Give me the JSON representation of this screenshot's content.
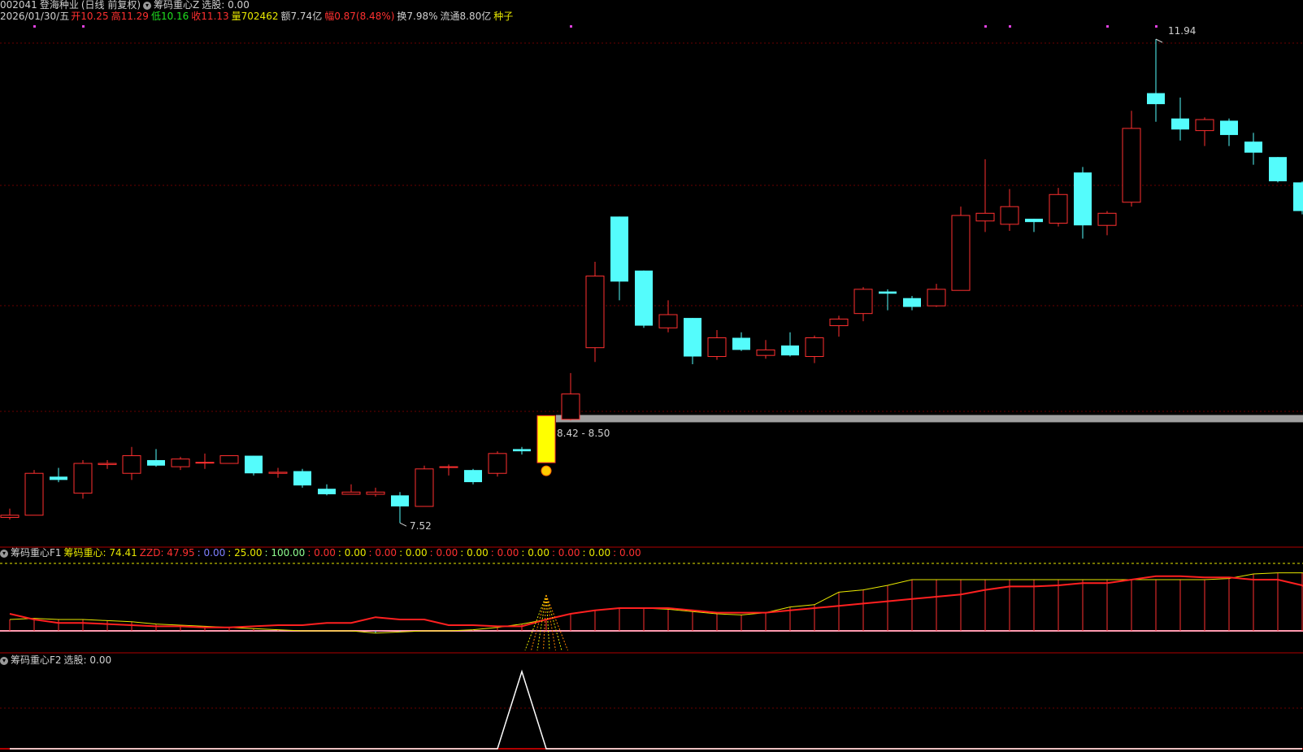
{
  "header": {
    "code": "002041",
    "name": "登海种业",
    "period": "(日线 前复权)",
    "formula": "筹码重心Z",
    "select_label": "选股: 0.00"
  },
  "quote": {
    "date": "2026/01/30/五",
    "open_label": "开10.25",
    "high_label": "高11.29",
    "low_label": "低10.16",
    "close_label": "收11.13",
    "volume_label": "量702462",
    "amount_label": "额7.74亿",
    "change_label": "幅0.87(8.48%)",
    "turnover_label": "换7.98%",
    "float_label": "流通8.80亿",
    "tag": "种子"
  },
  "main_chart": {
    "max_label": "11.94",
    "min_label": "7.52",
    "band_label": "8.42 - 8.50"
  },
  "f1": {
    "title": "筹码重心F1",
    "items": [
      {
        "text": "筹码重心: 74.41",
        "color": "#e8e800"
      },
      {
        "text": "ZZD: 47.95",
        "color": "#ff3030"
      },
      {
        "text": ": 0.00",
        "color": "#8080ff"
      },
      {
        "text": ": 25.00",
        "color": "#e8e800"
      },
      {
        "text": ": 100.00",
        "color": "#90ff90"
      },
      {
        "text": ": 0.00",
        "color": "#ff3030"
      },
      {
        "text": ": 0.00",
        "color": "#e8e800"
      },
      {
        "text": ": 0.00",
        "color": "#ff3030"
      },
      {
        "text": ": 0.00",
        "color": "#e8e800"
      },
      {
        "text": ": 0.00",
        "color": "#ff3030"
      },
      {
        "text": ": 0.00",
        "color": "#e8e800"
      },
      {
        "text": ": 0.00",
        "color": "#ff3030"
      },
      {
        "text": ": 0.00",
        "color": "#e8e800"
      },
      {
        "text": ": 0.00",
        "color": "#ff3030"
      },
      {
        "text": ": 0.00",
        "color": "#e8e800"
      },
      {
        "text": ": 0.00",
        "color": "#ff3030"
      }
    ]
  },
  "f2": {
    "title": "筹码重心F2",
    "select_label": "选股: 0.00"
  },
  "chart_data": {
    "type": "candlestick",
    "up_color": "#ff3030",
    "down_color": "#54fcfc",
    "signal_color": "#ffff00",
    "ylim": [
      7.5,
      12.0
    ],
    "candles": [
      {
        "o": 7.6,
        "h": 7.68,
        "l": 7.58,
        "c": 7.62
      },
      {
        "o": 7.62,
        "h": 8.03,
        "l": 7.62,
        "c": 8.0
      },
      {
        "o": 7.97,
        "h": 8.05,
        "l": 7.92,
        "c": 7.94
      },
      {
        "o": 7.82,
        "h": 8.12,
        "l": 7.77,
        "c": 8.09
      },
      {
        "o": 8.08,
        "h": 8.12,
        "l": 8.04,
        "c": 8.09
      },
      {
        "o": 8.0,
        "h": 8.24,
        "l": 7.94,
        "c": 8.16
      },
      {
        "o": 8.12,
        "h": 8.22,
        "l": 8.06,
        "c": 8.07
      },
      {
        "o": 8.06,
        "h": 8.15,
        "l": 8.03,
        "c": 8.13
      },
      {
        "o": 8.1,
        "h": 8.18,
        "l": 8.04,
        "c": 8.1
      },
      {
        "o": 8.09,
        "h": 8.16,
        "l": 8.09,
        "c": 8.16
      },
      {
        "o": 8.16,
        "h": 8.16,
        "l": 7.98,
        "c": 8.0
      },
      {
        "o": 8.0,
        "h": 8.05,
        "l": 7.96,
        "c": 8.01
      },
      {
        "o": 8.02,
        "h": 8.04,
        "l": 7.87,
        "c": 7.89
      },
      {
        "o": 7.86,
        "h": 7.9,
        "l": 7.8,
        "c": 7.81
      },
      {
        "o": 7.81,
        "h": 7.9,
        "l": 7.81,
        "c": 7.83
      },
      {
        "o": 7.81,
        "h": 7.87,
        "l": 7.79,
        "c": 7.83
      },
      {
        "o": 7.8,
        "h": 7.83,
        "l": 7.55,
        "c": 7.7
      },
      {
        "o": 7.7,
        "h": 8.07,
        "l": 7.7,
        "c": 8.04
      },
      {
        "o": 8.06,
        "h": 8.08,
        "l": 7.98,
        "c": 8.06
      },
      {
        "o": 8.03,
        "h": 8.04,
        "l": 7.9,
        "c": 7.92
      },
      {
        "o": 8.0,
        "h": 8.2,
        "l": 7.97,
        "c": 8.18
      },
      {
        "o": 8.22,
        "h": 8.24,
        "l": 8.17,
        "c": 8.2
      },
      {
        "o": 8.2,
        "h": 8.42,
        "l": 8.2,
        "c": 8.42,
        "signal": true
      },
      {
        "o": 8.49,
        "h": 8.91,
        "l": 8.48,
        "c": 8.72
      },
      {
        "o": 9.14,
        "h": 9.92,
        "l": 9.01,
        "c": 9.79
      },
      {
        "o": 10.33,
        "h": 10.33,
        "l": 9.57,
        "c": 9.74
      },
      {
        "o": 9.84,
        "h": 9.84,
        "l": 9.32,
        "c": 9.34
      },
      {
        "o": 9.32,
        "h": 9.57,
        "l": 9.28,
        "c": 9.44
      },
      {
        "o": 9.41,
        "h": 9.41,
        "l": 8.99,
        "c": 9.06
      },
      {
        "o": 9.06,
        "h": 9.3,
        "l": 9.03,
        "c": 9.23
      },
      {
        "o": 9.23,
        "h": 9.28,
        "l": 9.11,
        "c": 9.12
      },
      {
        "o": 9.07,
        "h": 9.21,
        "l": 9.04,
        "c": 9.12
      },
      {
        "o": 9.16,
        "h": 9.28,
        "l": 9.06,
        "c": 9.07
      },
      {
        "o": 9.06,
        "h": 9.25,
        "l": 9.0,
        "c": 9.23
      },
      {
        "o": 9.34,
        "h": 9.43,
        "l": 9.24,
        "c": 9.4
      },
      {
        "o": 9.45,
        "h": 9.69,
        "l": 9.38,
        "c": 9.67
      },
      {
        "o": 9.65,
        "h": 9.67,
        "l": 9.48,
        "c": 9.63
      },
      {
        "o": 9.59,
        "h": 9.61,
        "l": 9.48,
        "c": 9.51
      },
      {
        "o": 9.52,
        "h": 9.72,
        "l": 9.51,
        "c": 9.67
      },
      {
        "o": 9.66,
        "h": 10.42,
        "l": 9.66,
        "c": 10.34
      },
      {
        "o": 10.29,
        "h": 10.85,
        "l": 10.19,
        "c": 10.36
      },
      {
        "o": 10.26,
        "h": 10.58,
        "l": 10.2,
        "c": 10.42
      },
      {
        "o": 10.31,
        "h": 10.31,
        "l": 10.19,
        "c": 10.28
      },
      {
        "o": 10.27,
        "h": 10.59,
        "l": 10.24,
        "c": 10.53
      },
      {
        "o": 10.73,
        "h": 10.78,
        "l": 10.13,
        "c": 10.25
      },
      {
        "o": 10.25,
        "h": 10.38,
        "l": 10.16,
        "c": 10.36
      },
      {
        "o": 10.46,
        "h": 11.29,
        "l": 10.42,
        "c": 11.13
      },
      {
        "o": 11.45,
        "h": 11.94,
        "l": 11.19,
        "c": 11.35
      },
      {
        "o": 11.22,
        "h": 11.41,
        "l": 11.02,
        "c": 11.12
      },
      {
        "o": 11.11,
        "h": 11.23,
        "l": 10.97,
        "c": 11.21
      },
      {
        "o": 11.2,
        "h": 11.22,
        "l": 10.97,
        "c": 11.07
      },
      {
        "o": 11.01,
        "h": 11.09,
        "l": 10.8,
        "c": 10.91
      },
      {
        "o": 10.87,
        "h": 10.87,
        "l": 10.64,
        "c": 10.65
      },
      {
        "o": 10.64,
        "h": 10.65,
        "l": 10.35,
        "c": 10.38
      }
    ],
    "markers": [
      1,
      3,
      23,
      40,
      41,
      45,
      47
    ],
    "max_index": 47,
    "min_index": 16,
    "signal_index": 22,
    "band_range": [
      8.42,
      8.5
    ],
    "f1": {
      "ylim": [
        0,
        100
      ],
      "levels": [
        0,
        25,
        100
      ],
      "chip_center": [
        10,
        11,
        10,
        10,
        9,
        8,
        6,
        5,
        4,
        3,
        2,
        1,
        0,
        0,
        0,
        -2,
        -1,
        0,
        0,
        1,
        3,
        6,
        10,
        15,
        18,
        20,
        20,
        19,
        17,
        15,
        14,
        16,
        21,
        23,
        34,
        36,
        40,
        45,
        45,
        45,
        45,
        45,
        45,
        45,
        45,
        45,
        45,
        45,
        45,
        45,
        46,
        50,
        51,
        51,
        48
      ],
      "zzd": [
        15,
        10,
        7,
        7,
        6,
        5,
        4,
        4,
        3,
        3,
        4,
        5,
        5,
        7,
        7,
        12,
        10,
        10,
        5,
        5,
        4,
        4,
        10,
        15,
        18,
        20,
        20,
        20,
        18,
        16,
        16,
        16,
        18,
        20,
        22,
        24,
        26,
        28,
        30,
        32,
        36,
        39,
        39,
        40,
        42,
        42,
        45,
        48,
        48,
        47,
        47,
        45,
        45,
        40,
        30
      ]
    },
    "f2": {
      "ylim": [
        0,
        1
      ],
      "select_values": [
        0,
        0,
        0,
        0,
        0,
        0,
        0,
        0,
        0,
        0,
        0,
        0,
        0,
        0,
        0,
        0,
        0,
        0,
        0,
        0,
        0,
        1,
        0,
        0,
        0,
        0,
        0,
        0,
        0,
        0,
        0,
        0,
        0,
        0,
        0,
        0,
        0,
        0,
        0,
        0,
        0,
        0,
        0,
        0,
        0,
        0,
        0,
        0,
        0,
        0,
        0,
        0,
        0,
        0
      ]
    }
  }
}
